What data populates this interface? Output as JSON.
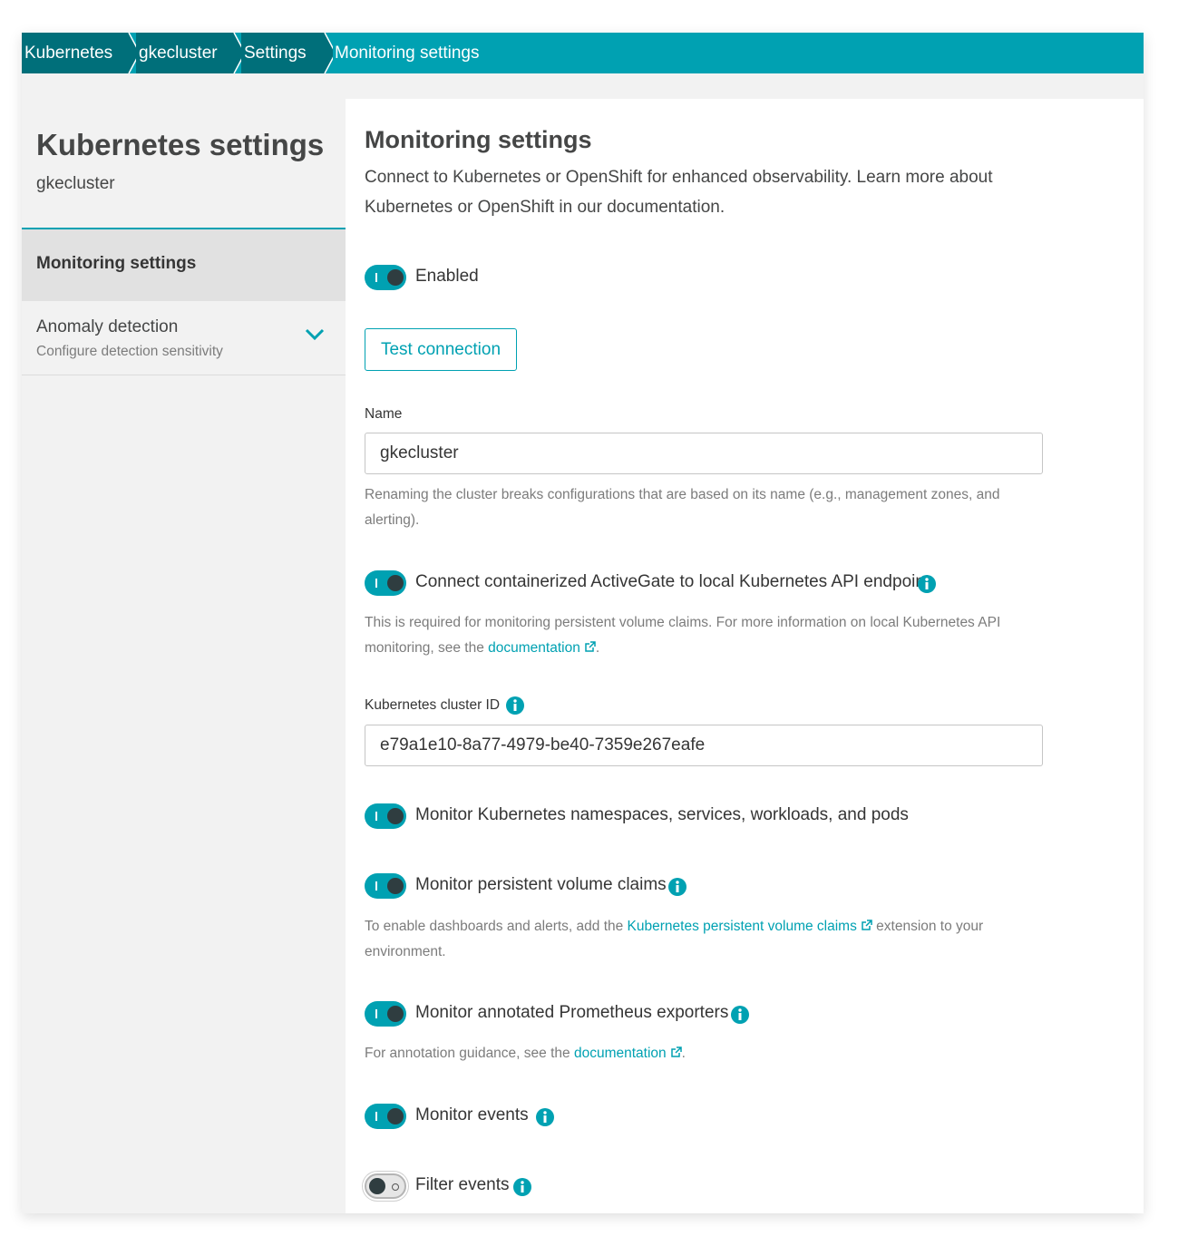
{
  "breadcrumb": {
    "items": [
      "Kubernetes",
      "gkecluster",
      "Settings",
      "Monitoring settings"
    ]
  },
  "sidebar": {
    "title": "Kubernetes settings",
    "subtitle": "gkecluster",
    "active_item": "Monitoring settings",
    "items": [
      {
        "label": "Anomaly detection",
        "description": "Configure detection sensitivity"
      }
    ]
  },
  "main": {
    "title": "Monitoring settings",
    "description": "Connect to Kubernetes or OpenShift for enhanced observability. Learn more about Kubernetes or OpenShift in our documentation.",
    "enabled_label": "Enabled",
    "test_button": "Test connection",
    "name_label": "Name",
    "name_value": "gkecluster",
    "name_help": "Renaming the cluster breaks configurations that are based on its name (e.g., management zones, and alerting).",
    "connect_ag_label": "Connect containerized ActiveGate to local Kubernetes API endpoint",
    "connect_ag_help_prefix": "This is required for monitoring persistent volume claims. For more information on local Kubernetes API monitoring, see the ",
    "connect_ag_help_link": "documentation",
    "connect_ag_help_suffix": ".",
    "cluster_id_label": "Kubernetes cluster ID",
    "cluster_id_value": "e79a1e10-8a77-4979-be40-7359e267eafe",
    "monitor_namespaces_label": "Monitor Kubernetes namespaces, services, workloads, and pods",
    "monitor_pvc_label": "Monitor persistent volume claims",
    "pvc_help_prefix": "To enable dashboards and alerts, add the ",
    "pvc_help_link": "Kubernetes persistent volume claims",
    "pvc_help_suffix": " extension to your environment.",
    "prometheus_label": "Monitor annotated Prometheus exporters",
    "prometheus_help_prefix": "For annotation guidance, see the ",
    "prometheus_help_link": "documentation",
    "prometheus_help_suffix": ".",
    "events_label": "Monitor events",
    "filter_events_label": "Filter events"
  },
  "toggles": {
    "enabled": true,
    "connect_activegate": true,
    "monitor_namespaces": true,
    "monitor_pvc": true,
    "monitor_prometheus": true,
    "monitor_events": true,
    "filter_events": false
  },
  "colors": {
    "accent": "#00a1b2",
    "breadcrumb_dark": "#006f7a",
    "sidebar_bg": "#f2f2f2"
  },
  "icons": [
    "chevron-right-icon",
    "chevron-down-icon",
    "info-icon",
    "external-link-icon"
  ]
}
